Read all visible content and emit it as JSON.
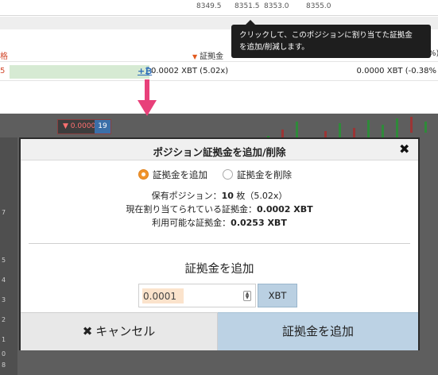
{
  "top": {
    "row1_values": [
      "8349.5",
      "8351.5",
      "8353.0",
      "8355.0"
    ],
    "header_left": "格",
    "header_margin_label": "証拠金",
    "header_pct": "%)",
    "position_left": "5",
    "position_add_symbol": "+₿",
    "position_margin_value": "0.0002 XBT (5.02x)",
    "position_right_value": "0.0000 XBT (-0.38%"
  },
  "tooltip": {
    "line1": "クリックして、このポジションに割り当てた証拠金",
    "line2": "を追加/削減します。"
  },
  "background": {
    "order_label": "▼ 0.0000",
    "order_badge": "19",
    "left_numbers": [
      "7",
      "",
      "5",
      "4",
      "3",
      "2",
      "1",
      "0",
      "8"
    ]
  },
  "modal": {
    "title": "ポジション証拠金を追加/削除",
    "close_glyph": "✖",
    "radio_add_label": "証拠金を追加",
    "radio_remove_label": "証拠金を削除",
    "held_position_label": "保有ポジション：",
    "held_position_value": "10",
    "held_position_unit": " 枚（5.02x）",
    "allocated_label": "現在割り当てられている証拠金：",
    "allocated_value": "0.0002 XBT",
    "available_label": "利用可能な証拠金：",
    "available_value": "0.0253 XBT",
    "section_title": "証拠金を追加",
    "amount_value": "0.0001",
    "amount_unit": "XBT",
    "cancel_label": "キャンセル",
    "cancel_icon": "✖",
    "submit_label": "証拠金を追加"
  },
  "colors": {
    "tooltip_bg": "#1e1e1e",
    "arrow": "#e8407a",
    "radio_checked": "#f0932b",
    "submit_bg": "#bcd2e4",
    "input_highlight": "#fbe3cc"
  }
}
